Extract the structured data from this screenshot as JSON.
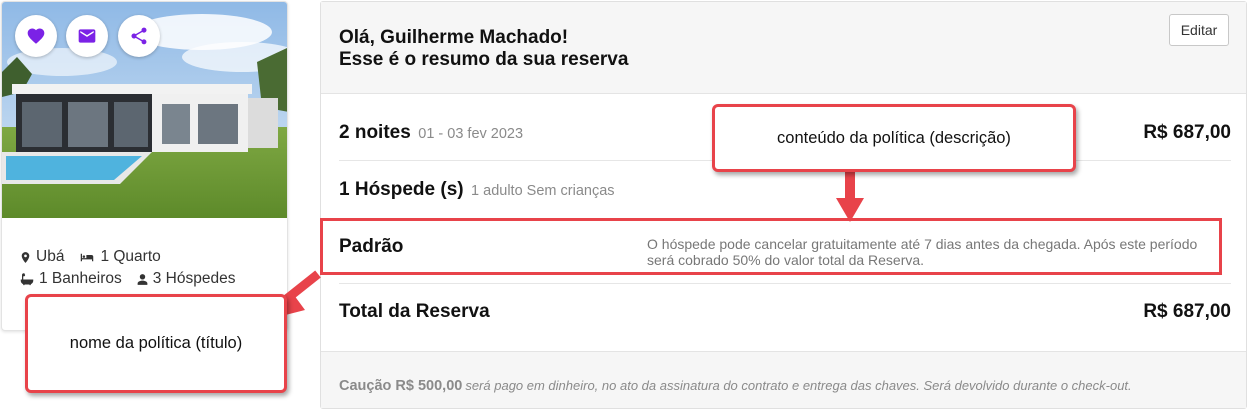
{
  "property": {
    "location": "Ubá",
    "bedrooms": "1 Quarto",
    "bathrooms": "1 Banheiros",
    "guests": "3 Hóspedes",
    "icons": {
      "favorite": "heart-icon",
      "message": "envelope-icon",
      "share": "share-icon",
      "location": "map-marker-icon",
      "bed": "bed-icon",
      "bath": "bath-icon",
      "guests": "user-icon"
    }
  },
  "summary": {
    "greeting_line1": "Olá, Guilherme Machado!",
    "greeting_line2": "Esse é o resumo da sua reserva",
    "edit_label": "Editar",
    "nights_label": "2 noites",
    "nights_dates": "01 - 03 fev 2023",
    "nights_price": "R$ 687,00",
    "guests_label": "1 Hóspede (s)",
    "guests_detail": "1 adulto Sem crianças",
    "policy_name": "Padrão",
    "policy_description": "O hóspede pode cancelar gratuitamente até 7 dias antes da chegada. Após este período será cobrado 50% do valor total da Reserva.",
    "total_label": "Total da Reserva",
    "total_price": "R$ 687,00",
    "deposit_label": "Caução R$ 500,00",
    "deposit_note": "será pago em dinheiro, no ato da assinatura do contrato e entrega das chaves. Será devolvido durante o check-out."
  },
  "annotations": {
    "description_callout": "conteúdo da política (descrição)",
    "title_callout": "nome da política (título)"
  },
  "colors": {
    "accent": "#7b22e6",
    "annotation": "#e8434a"
  }
}
